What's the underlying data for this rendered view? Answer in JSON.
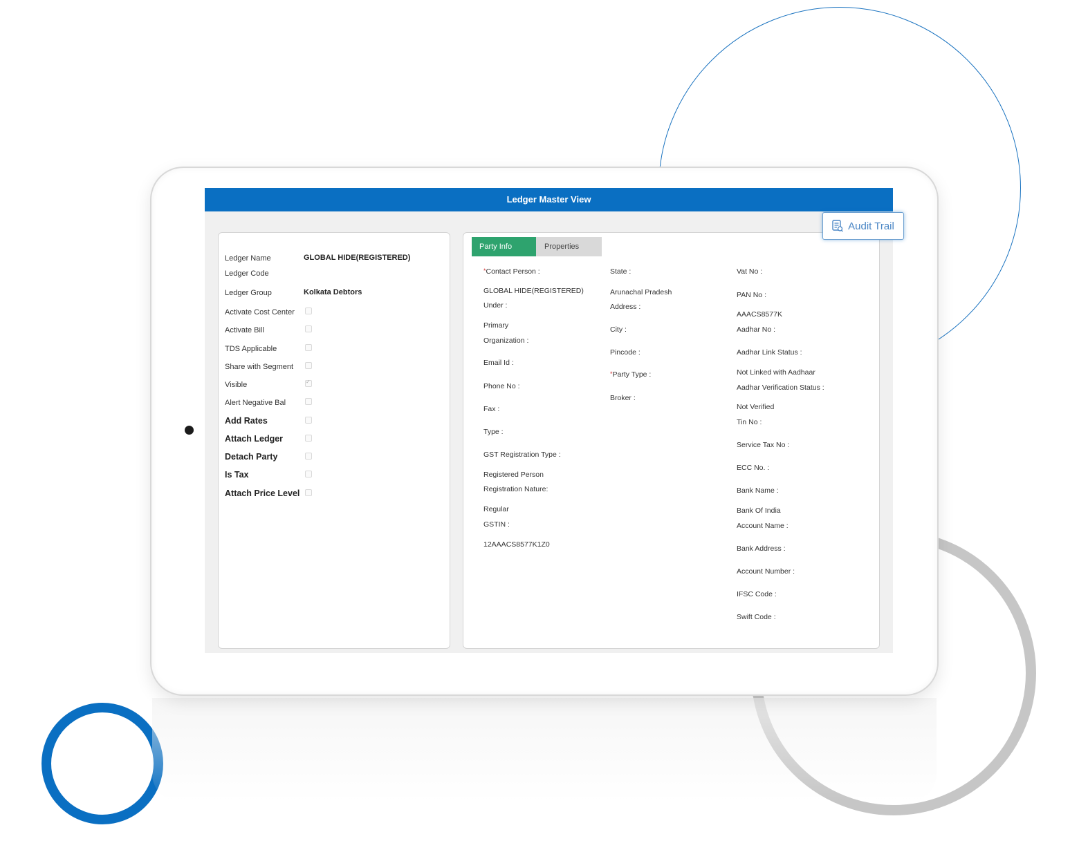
{
  "window": {
    "title": "Ledger Master View"
  },
  "audit_trail": {
    "label": "Audit Trail"
  },
  "ledger": {
    "fields": [
      {
        "label": "Ledger Name",
        "value": "GLOBAL HIDE(REGISTERED)"
      },
      {
        "label": "Ledger Code",
        "value": ""
      },
      {
        "label": "Ledger Group",
        "value": "Kolkata Debtors"
      }
    ],
    "options": [
      {
        "label": "Activate Cost Center",
        "checked": false
      },
      {
        "label": "Activate Bill",
        "checked": false
      },
      {
        "label": "TDS Applicable",
        "checked": false
      },
      {
        "label": "Share with Segment",
        "checked": false
      },
      {
        "label": "Visible",
        "checked": true
      },
      {
        "label": "Alert Negative Bal",
        "checked": false
      },
      {
        "label": "Add Rates",
        "checked": false
      },
      {
        "label": "Attach Ledger",
        "checked": false
      },
      {
        "label": "Detach Party",
        "checked": false
      },
      {
        "label": "Is Tax",
        "checked": false
      },
      {
        "label": "Attach Price Level",
        "checked": false
      }
    ]
  },
  "tabs": [
    {
      "label": "Party Info",
      "active": true
    },
    {
      "label": "Properties",
      "active": false
    }
  ],
  "party_info": {
    "col1": {
      "contact_person_label": "Contact Person :",
      "contact_person_value": "GLOBAL HIDE(REGISTERED)",
      "under_label": "Under :",
      "under_value": "Primary",
      "organization_label": "Organization :",
      "email_label": "Email Id :",
      "phone_label": "Phone No :",
      "fax_label": "Fax :",
      "type_label": "Type :",
      "gst_reg_type_label": "GST Registration Type :",
      "gst_reg_type_value": "Registered Person",
      "reg_nature_label": "Registration Nature:",
      "reg_nature_value": "Regular",
      "gstin_label": "GSTIN :",
      "gstin_value": "12AAACS8577K1Z0"
    },
    "col2": {
      "state_label": "State :",
      "state_value": "Arunachal Pradesh",
      "address_label": "Address :",
      "city_label": "City :",
      "pincode_label": "Pincode :",
      "party_type_label": "Party Type :",
      "broker_label": "Broker :"
    },
    "col3": {
      "vat_label": "Vat No :",
      "pan_label": "PAN No :",
      "pan_value": "AAACS8577K",
      "aadhar_label": "Aadhar No :",
      "aadhar_link_label": "Aadhar Link Status :",
      "aadhar_link_value": "Not Linked with Aadhaar",
      "aadhar_verif_label": "Aadhar Verification Status :",
      "aadhar_verif_value": "Not Verified",
      "tin_label": "Tin No :",
      "service_tax_label": "Service Tax No :",
      "ecc_label": "ECC No. :",
      "bank_name_label": "Bank Name :",
      "bank_name_value": "Bank Of India",
      "account_name_label": "Account Name :",
      "bank_address_label": "Bank Address :",
      "account_number_label": "Account Number :",
      "ifsc_label": "IFSC Code :",
      "swift_label": "Swift Code :"
    }
  }
}
